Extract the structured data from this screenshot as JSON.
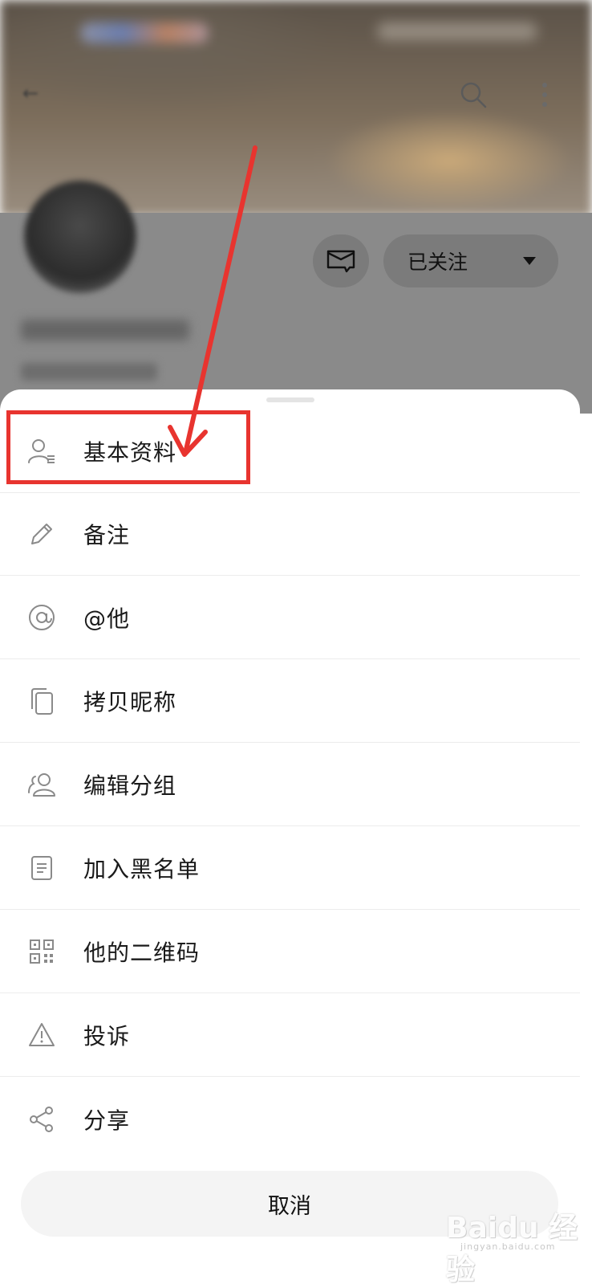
{
  "profile": {
    "follow_label": "已关注"
  },
  "menu": {
    "items": [
      {
        "label": "基本资料",
        "icon": "user-profile-icon"
      },
      {
        "label": "备注",
        "icon": "pencil-icon"
      },
      {
        "label": "@他",
        "icon": "at-icon"
      },
      {
        "label": "拷贝昵称",
        "icon": "copy-icon"
      },
      {
        "label": "编辑分组",
        "icon": "group-icon"
      },
      {
        "label": "加入黑名单",
        "icon": "document-icon"
      },
      {
        "label": "他的二维码",
        "icon": "qr-code-icon"
      },
      {
        "label": "投诉",
        "icon": "warning-icon"
      },
      {
        "label": "分享",
        "icon": "share-icon"
      }
    ],
    "cancel_label": "取消"
  },
  "watermark": {
    "text": "Baidu 经验",
    "sub": "jingyan.baidu.com"
  },
  "colors": {
    "annotation": "#e8342f",
    "sheet_bg": "#ffffff",
    "cancel_bg": "#f4f4f4",
    "icon_gray": "#8a8a8a"
  }
}
